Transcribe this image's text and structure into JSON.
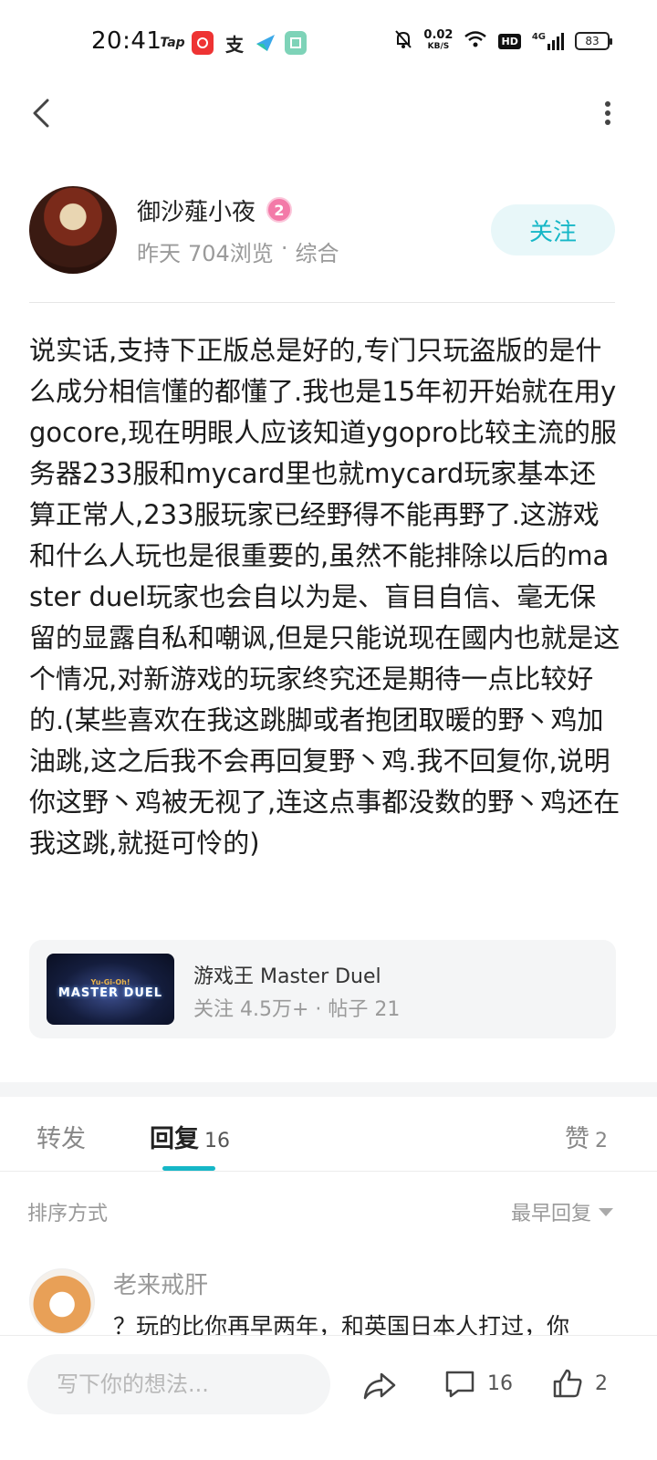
{
  "status_bar": {
    "time": "20:41",
    "apps": [
      "Tap",
      "网易云音乐",
      "支付宝",
      "飞书",
      "微信读书"
    ],
    "net_speed": "0.02",
    "net_unit": "KB/S",
    "hd": "HD",
    "signal": "4G",
    "battery": "83"
  },
  "nav": {
    "back_icon": "chevron-left-icon",
    "more_icon": "more-vertical-icon"
  },
  "author": {
    "name": "御沙薤小夜",
    "level": "2",
    "time": "昨天",
    "views": "704浏览",
    "separator": "·",
    "category": "综合",
    "follow_label": "关注"
  },
  "post": {
    "body": "说实话,支持下正版总是好的,专门只玩盗版的是什么成分相信懂的都懂了.我也是15年初开始就在用ygocore,现在明眼人应该知道ygopro比较主流的服务器233服和mycard里也就mycard玩家基本还算正常人,233服玩家已经野得不能再野了.这游戏和什么人玩也是很重要的,虽然不能排除以后的master duel玩家也会自以为是、盲目自信、毫无保留的显露自私和嘲讽,但是只能说现在國内也就是这个情况,对新游戏的玩家终究还是期待一点比较好的.(某些喜欢在我这跳脚或者抱团取暖的野丶鸡加油跳,这之后我不会再回复野丶鸡.我不回复你,说明你这野丶鸡被无视了,连这点事都没数的野丶鸡还在我这跳,就挺可怜的)"
  },
  "game_card": {
    "thumb_logo_top": "Yu-Gi-Oh!",
    "thumb_logo": "MASTER DUEL",
    "title": "游戏王 Master Duel",
    "stats": "关注 4.5万+ · 帖子 21"
  },
  "tabs": {
    "repost": "转发",
    "reply": "回复",
    "reply_count": "16",
    "like": "赞",
    "like_count": "2",
    "active_color": "#16b7c7"
  },
  "sort": {
    "label": "排序方式",
    "selected": "最早回复"
  },
  "comments": [
    {
      "user": "老来戒肝",
      "text": "？玩的比你再早两年，和英国日本人打过，你"
    }
  ],
  "bottom_bar": {
    "placeholder": "写下你的想法...",
    "comment_count": "16",
    "like_count": "2"
  }
}
